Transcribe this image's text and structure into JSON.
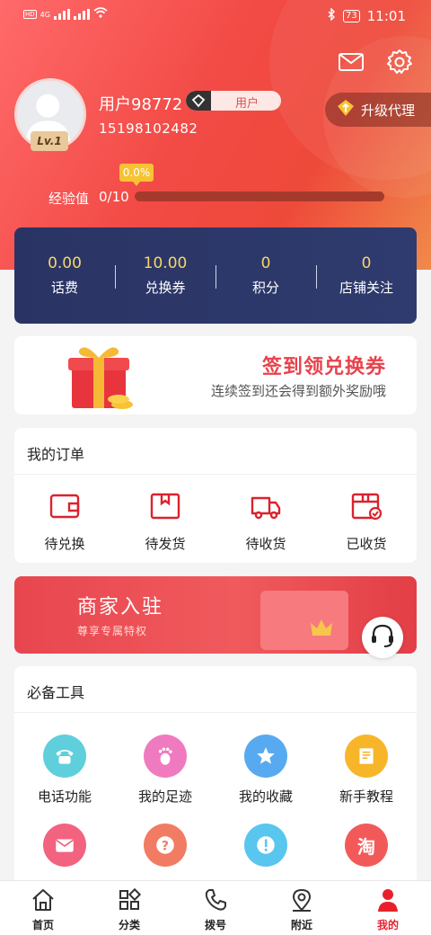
{
  "status_bar": {
    "network": "4G",
    "battery": "73",
    "time": "11:01"
  },
  "profile": {
    "username": "用户98772",
    "role_badge": "用户",
    "phone": "15198102482",
    "level": "Lv.1",
    "upgrade_label": "升级代理",
    "exp_tip": "0.0%",
    "exp_label": "经验值",
    "exp_value": "0/10",
    "exp_progress": 0
  },
  "stats": [
    {
      "value": "0.00",
      "label": "话费"
    },
    {
      "value": "10.00",
      "label": "兑换券"
    },
    {
      "value": "0",
      "label": "积分"
    },
    {
      "value": "0",
      "label": "店铺关注"
    }
  ],
  "signin": {
    "title": "签到领兑换券",
    "subtitle": "连续签到还会得到额外奖励哦"
  },
  "orders": {
    "title": "我的订单",
    "items": [
      {
        "label": "待兑换",
        "icon": "wallet-icon"
      },
      {
        "label": "待发货",
        "icon": "package-icon"
      },
      {
        "label": "待收货",
        "icon": "truck-icon"
      },
      {
        "label": "已收货",
        "icon": "received-box-icon"
      }
    ]
  },
  "merchant_banner": {
    "title": "商家入驻",
    "subtitle": "尊享专属特权"
  },
  "tools": {
    "title": "必备工具",
    "items": [
      {
        "label": "电话功能",
        "icon": "phone-icon",
        "color": "#5fcfdc"
      },
      {
        "label": "我的足迹",
        "icon": "footprint-icon",
        "color": "#f07ac0"
      },
      {
        "label": "我的收藏",
        "icon": "star-icon",
        "color": "#58aaf0"
      },
      {
        "label": "新手教程",
        "icon": "book-icon",
        "color": "#f7b62a"
      },
      {
        "label": "",
        "icon": "mail-icon",
        "color": "#f2637f"
      },
      {
        "label": "",
        "icon": "help-icon",
        "color": "#f27c63"
      },
      {
        "label": "",
        "icon": "info-icon",
        "color": "#58c6ee"
      },
      {
        "label": "淘",
        "icon": "taobao-icon",
        "color": "#f25a5a"
      }
    ]
  },
  "tabbar": [
    {
      "label": "首页",
      "icon": "home-icon"
    },
    {
      "label": "分类",
      "icon": "grid-icon"
    },
    {
      "label": "拨号",
      "icon": "dial-icon"
    },
    {
      "label": "附近",
      "icon": "location-icon"
    },
    {
      "label": "我的",
      "icon": "person-icon",
      "active": true
    }
  ],
  "colors": {
    "brand_red": "#e8202d",
    "stats_bg": "#2a3464",
    "stats_value": "#f5d66a"
  }
}
